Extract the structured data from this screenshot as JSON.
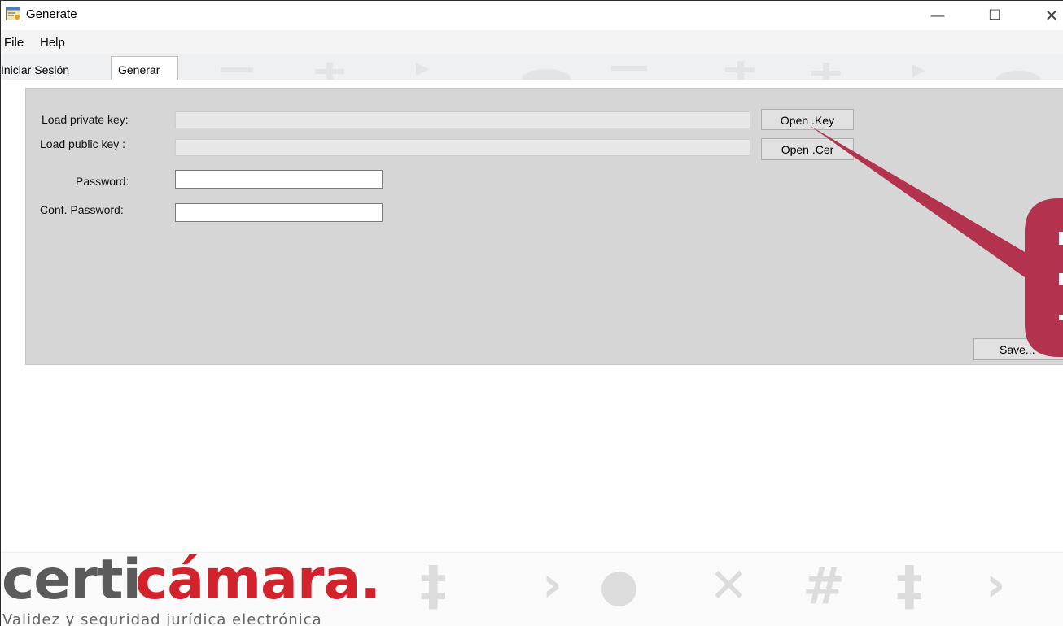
{
  "window": {
    "title": "Generate",
    "controls": {
      "minimize": "—",
      "maximize": "☐",
      "close": "✕"
    }
  },
  "menu": {
    "items": [
      "File",
      "Help"
    ]
  },
  "tabs": [
    {
      "label": "Iniciar Sesión",
      "active": false
    },
    {
      "label": "Generar",
      "active": true
    }
  ],
  "form": {
    "private_key": {
      "label": "Load private key:",
      "value": "",
      "button": "Open .Key"
    },
    "public_key": {
      "label": "Load public key :",
      "value": "",
      "button": "Open .Cer"
    },
    "password": {
      "label": "Password:",
      "value": ""
    },
    "confirm_password": {
      "label": "Conf. Password:",
      "value": ""
    },
    "save_button": "Save..."
  },
  "annotation": {
    "color": "#b3334f",
    "points_to": "Open .Key"
  },
  "footer": {
    "logo_part1": "certi",
    "logo_part2": "cámara.",
    "tagline": "Validez y seguridad jurídica electrónica",
    "brand_colors": {
      "gray": "#5b5b5b",
      "red": "#d2222b"
    }
  },
  "icons": [
    "app-icon",
    "minimize-icon",
    "maximize-icon",
    "close-icon"
  ]
}
